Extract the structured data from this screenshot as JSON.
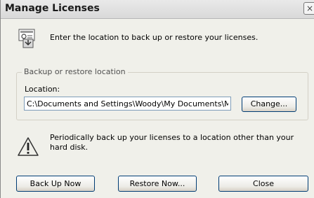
{
  "window": {
    "title": "Manage Licenses",
    "close_glyph": "×"
  },
  "intro": {
    "icon": "license-certificate-icon",
    "text": "Enter the location to back up or restore your licenses."
  },
  "location_group": {
    "legend": "Backup or restore location",
    "label": "Location:",
    "value": "C:\\Documents and Settings\\Woody\\My Documents\\M",
    "change_button": "Change..."
  },
  "warning": {
    "icon": "warning-icon",
    "text": "Periodically back up your licenses to a location other than your hard disk."
  },
  "buttons": {
    "back_up_now": "Back Up Now",
    "restore_now": "Restore Now...",
    "close": "Close"
  },
  "colors": {
    "dialog_background": "#f0f0ea",
    "button_border": "#003c74",
    "input_border": "#7f9db9"
  }
}
